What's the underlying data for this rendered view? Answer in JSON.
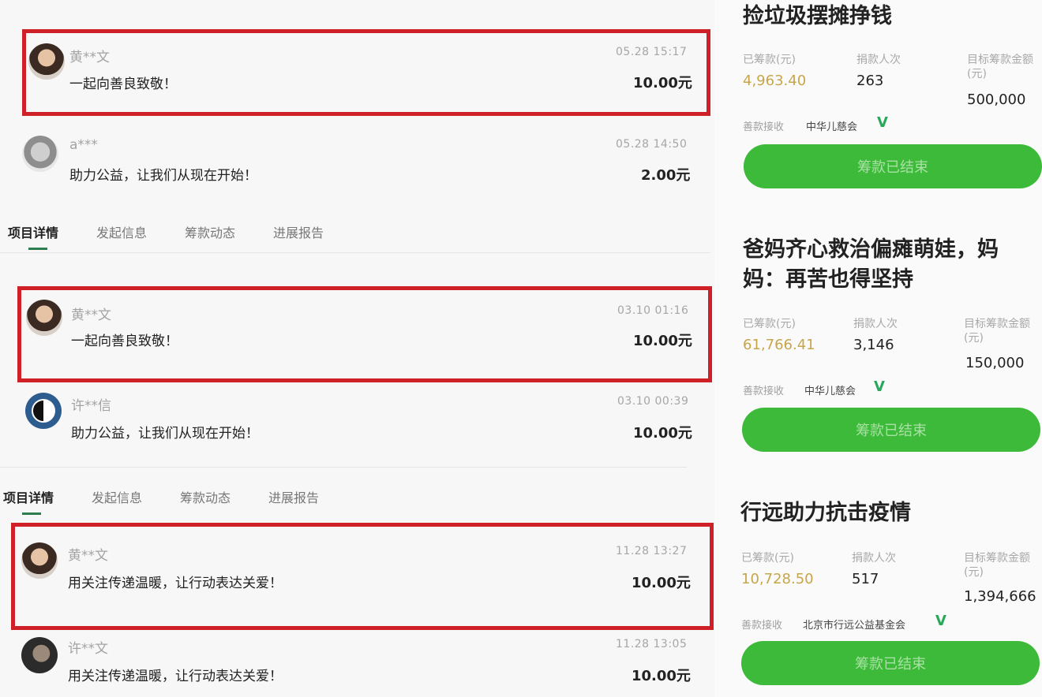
{
  "donations_group1": [
    {
      "name": "黄**文",
      "time": "05.28 15:17",
      "message": "一起向善良致敬！",
      "amount": "10.00元"
    },
    {
      "name": "a***",
      "time": "05.28 14:50",
      "message": "助力公益，让我们从现在开始！",
      "amount": "2.00元"
    }
  ],
  "tabs1": {
    "items": [
      "项目详情",
      "发起信息",
      "筹款动态",
      "进展报告"
    ]
  },
  "donations_group2": [
    {
      "name": "黄**文",
      "time": "03.10 01:16",
      "message": "一起向善良致敬！",
      "amount": "10.00元"
    },
    {
      "name": "许**信",
      "time": "03.10 00:39",
      "message": "助力公益，让我们从现在开始！",
      "amount": "10.00元"
    }
  ],
  "tabs2": {
    "items": [
      "项目详情",
      "发起信息",
      "筹款动态",
      "进展报告"
    ]
  },
  "donations_group3": [
    {
      "name": "黄**文",
      "time": "11.28 13:27",
      "message": "用关注传递温暖，让行动表达关爱！",
      "amount": "10.00元"
    },
    {
      "name": "许**文",
      "time": "11.28 13:05",
      "message": "用关注传递温暖，让行动表达关爱！",
      "amount": "10.00元"
    }
  ],
  "projects": [
    {
      "title": "捡垃圾摆摊挣钱",
      "raised_label": "已筹款(元)",
      "raised": "4,963.40",
      "donors_label": "捐款人次",
      "donors": "263",
      "target_label": "目标筹款金额(元)",
      "target": "500,000",
      "org_label": "善款接收",
      "org_name": "中华儿慈会",
      "verified": "V",
      "button": "筹款已结束"
    },
    {
      "title": "爸妈齐心救治偏瘫萌娃，妈妈：再苦也得坚持",
      "raised_label": "已筹款(元)",
      "raised": "61,766.41",
      "donors_label": "捐款人次",
      "donors": "3,146",
      "target_label": "目标筹款金额(元)",
      "target": "150,000",
      "org_label": "善款接收",
      "org_name": "中华儿慈会",
      "verified": "V",
      "button": "筹款已结束"
    },
    {
      "title": "行远助力抗击疫情",
      "raised_label": "已筹款(元)",
      "raised": "10,728.50",
      "donors_label": "捐款人次",
      "donors": "517",
      "target_label": "目标筹款金额(元)",
      "target": "1,394,666",
      "org_label": "善款接收",
      "org_name": "北京市行远公益基金会",
      "verified": "V",
      "button": "筹款已结束"
    }
  ],
  "colors": {
    "highlight": "#cf1f27",
    "button": "#3dba3a",
    "verified": "#27a85a",
    "gold": "#c7a54a"
  }
}
